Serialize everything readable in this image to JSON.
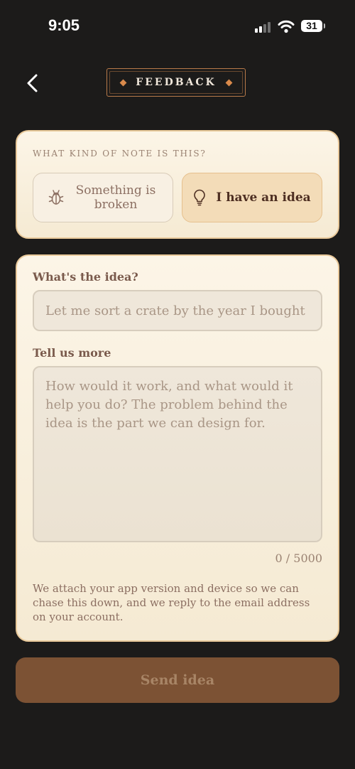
{
  "status_bar": {
    "time": "9:05",
    "battery": "31",
    "icons": [
      "signal-icon",
      "wifi-icon",
      "battery-icon"
    ]
  },
  "header": {
    "back_icon": "chevron-left-icon",
    "title": "FEEDBACK"
  },
  "note_type": {
    "label": "WHAT KIND OF NOTE IS THIS?",
    "options": [
      {
        "label": "Something is broken",
        "icon": "bug-icon",
        "selected": false
      },
      {
        "label": "I have an idea",
        "icon": "lightbulb-icon",
        "selected": true
      }
    ]
  },
  "form": {
    "idea_label": "What's the idea?",
    "idea_value": "",
    "idea_placeholder": "Let me sort a crate by the year I bought each",
    "more_label": "Tell us more",
    "more_value": "",
    "more_placeholder": "How would it work, and what would it help you do? The problem behind the idea is the part we can design for.",
    "char_count": "0 / 5000",
    "footnote": "We attach your app version and device so we can chase this down, and we reply to the email address on your account."
  },
  "send_button": {
    "label": "Send idea",
    "enabled": false
  },
  "colors": {
    "background": "#1c1b1a",
    "card": "#fcf5e7",
    "accent": "#d98a4b",
    "selected_option": "#f3dcb8",
    "button": "#7c5234",
    "button_text": "#a88566"
  }
}
